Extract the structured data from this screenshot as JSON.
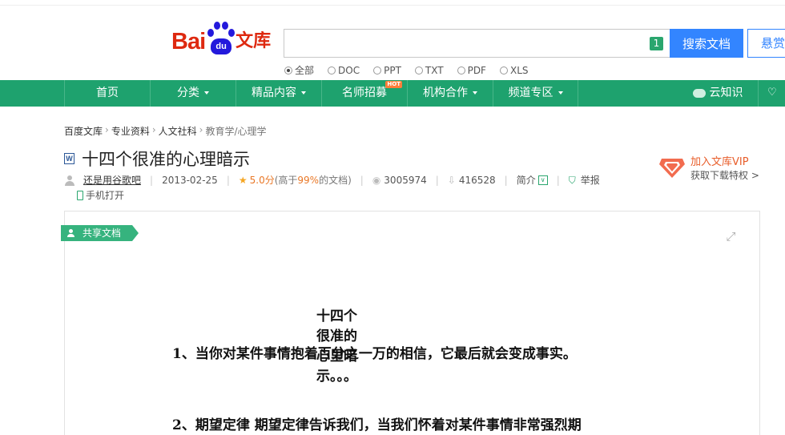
{
  "header": {
    "logo": {
      "bai": "Bai",
      "du": "du",
      "wenku": "文库"
    },
    "search": {
      "value": "",
      "placeholder": "",
      "badge": "1"
    },
    "search_button": "搜索文档",
    "reward_button": "悬赏",
    "filters": [
      {
        "label": "全部",
        "checked": true
      },
      {
        "label": "DOC",
        "checked": false
      },
      {
        "label": "PPT",
        "checked": false
      },
      {
        "label": "TXT",
        "checked": false
      },
      {
        "label": "PDF",
        "checked": false
      },
      {
        "label": "XLS",
        "checked": false
      }
    ]
  },
  "nav": {
    "items": [
      {
        "label": "首页"
      },
      {
        "label": "分类"
      },
      {
        "label": "精品内容"
      },
      {
        "label": "名师招募",
        "badge": "HOT"
      },
      {
        "label": "机构合作"
      },
      {
        "label": "频道专区"
      }
    ],
    "cloud": "云知识"
  },
  "breadcrumb": [
    "百度文库",
    "专业资料",
    "人文社科",
    "教育学/心理学"
  ],
  "document": {
    "type_icon": "W",
    "title": "十四个很准的心理暗示",
    "author": "还是用谷歌吧",
    "date": "2013-02-25",
    "rating": "5.0分",
    "rating_note_prefix": "(高于",
    "rating_percent": "99%",
    "rating_note_suffix": "的文档)",
    "views": "3005974",
    "downloads": "416528",
    "intro": "简介",
    "report": "举报",
    "phone_open": "手机打开"
  },
  "vip": {
    "title": "加入文库VIP",
    "subtitle": "获取下载特权 >"
  },
  "viewer": {
    "share_tag": "共享文档",
    "heading": "十四个很准的心里暗示。。。",
    "paragraphs": [
      "1、当你对某件事情抱着百分之一万的相信，它最后就会变成事实。",
      "2、期望定律 期望定律告诉我们，当我们怀着对某件事情非常强烈期"
    ]
  },
  "colors": {
    "nav_green": "#1ea26e",
    "search_blue": "#3385ff",
    "logo_red": "#de2910",
    "logo_blue": "#2319dc"
  }
}
